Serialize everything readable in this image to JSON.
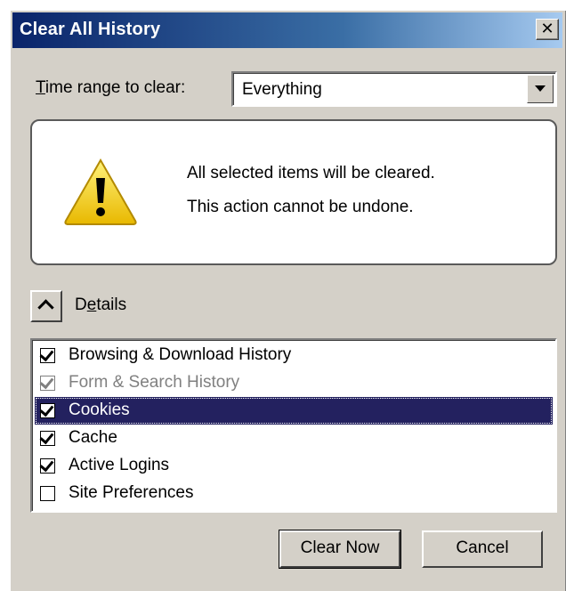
{
  "window": {
    "title": "Clear All History",
    "close_glyph": "✕"
  },
  "time_range": {
    "label_mnemonic": "T",
    "label_rest": "ime range to clear:",
    "selected": "Everything"
  },
  "warning": {
    "icon": "warning-icon",
    "line1": "All selected items will be cleared.",
    "line2": "This action cannot be undone."
  },
  "details": {
    "label_pre": "D",
    "label_mnemonic": "e",
    "label_post": "tails",
    "expanded": true
  },
  "items": [
    {
      "label": "Browsing & Download History",
      "checked": true,
      "disabled": false,
      "selected": false
    },
    {
      "label": "Form & Search History",
      "checked": true,
      "disabled": true,
      "selected": false
    },
    {
      "label": "Cookies",
      "checked": true,
      "disabled": false,
      "selected": true
    },
    {
      "label": "Cache",
      "checked": true,
      "disabled": false,
      "selected": false
    },
    {
      "label": "Active Logins",
      "checked": true,
      "disabled": false,
      "selected": false
    },
    {
      "label": "Site Preferences",
      "checked": false,
      "disabled": false,
      "selected": false
    }
  ],
  "buttons": {
    "clear_now": "Clear Now",
    "cancel": "Cancel"
  },
  "colors": {
    "dialog_bg": "#d4d0c8",
    "title_start": "#0a246a",
    "title_end": "#a6caf0",
    "selection": "#23215f",
    "warning_yellow": "#f5d000"
  }
}
